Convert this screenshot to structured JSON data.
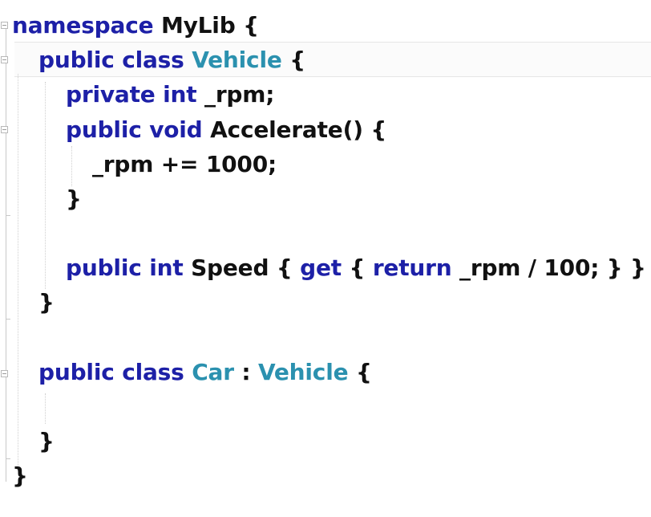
{
  "editor": {
    "code_lines": [
      [
        {
          "text": "namespace",
          "kind": "kw"
        },
        {
          "text": " MyLib {",
          "kind": "plain"
        }
      ],
      [
        {
          "text": "public",
          "kind": "kw"
        },
        {
          "text": " ",
          "kind": "plain"
        },
        {
          "text": "class",
          "kind": "kw"
        },
        {
          "text": " ",
          "kind": "plain"
        },
        {
          "text": "Vehicle",
          "kind": "type"
        },
        {
          "text": " {",
          "kind": "plain"
        }
      ],
      [
        {
          "text": "private",
          "kind": "kw"
        },
        {
          "text": " ",
          "kind": "plain"
        },
        {
          "text": "int",
          "kind": "kw"
        },
        {
          "text": " _rpm;",
          "kind": "plain"
        }
      ],
      [
        {
          "text": "public",
          "kind": "kw"
        },
        {
          "text": " ",
          "kind": "plain"
        },
        {
          "text": "void",
          "kind": "kw"
        },
        {
          "text": " Accelerate() {",
          "kind": "plain"
        }
      ],
      [
        {
          "text": "_rpm += 1000;",
          "kind": "plain"
        }
      ],
      [
        {
          "text": "}",
          "kind": "plain"
        }
      ],
      [],
      [
        {
          "text": "public",
          "kind": "kw"
        },
        {
          "text": " ",
          "kind": "plain"
        },
        {
          "text": "int",
          "kind": "kw"
        },
        {
          "text": " Speed { ",
          "kind": "plain"
        },
        {
          "text": "get",
          "kind": "kw"
        },
        {
          "text": " { ",
          "kind": "plain"
        },
        {
          "text": "return",
          "kind": "kw"
        },
        {
          "text": " _rpm / 100; } }",
          "kind": "plain"
        }
      ],
      [
        {
          "text": "}",
          "kind": "plain"
        }
      ],
      [],
      [
        {
          "text": "public",
          "kind": "kw"
        },
        {
          "text": " ",
          "kind": "plain"
        },
        {
          "text": "class",
          "kind": "kw"
        },
        {
          "text": " ",
          "kind": "plain"
        },
        {
          "text": "Car",
          "kind": "type"
        },
        {
          "text": " : ",
          "kind": "plain"
        },
        {
          "text": "Vehicle",
          "kind": "type"
        },
        {
          "text": " {",
          "kind": "plain"
        }
      ],
      [],
      [
        {
          "text": "}",
          "kind": "plain"
        }
      ],
      [
        {
          "text": "}",
          "kind": "plain"
        }
      ]
    ],
    "colors": {
      "keyword": "#1d20a7",
      "type": "#2b91af",
      "plain": "#111111",
      "background": "#ffffff"
    }
  }
}
